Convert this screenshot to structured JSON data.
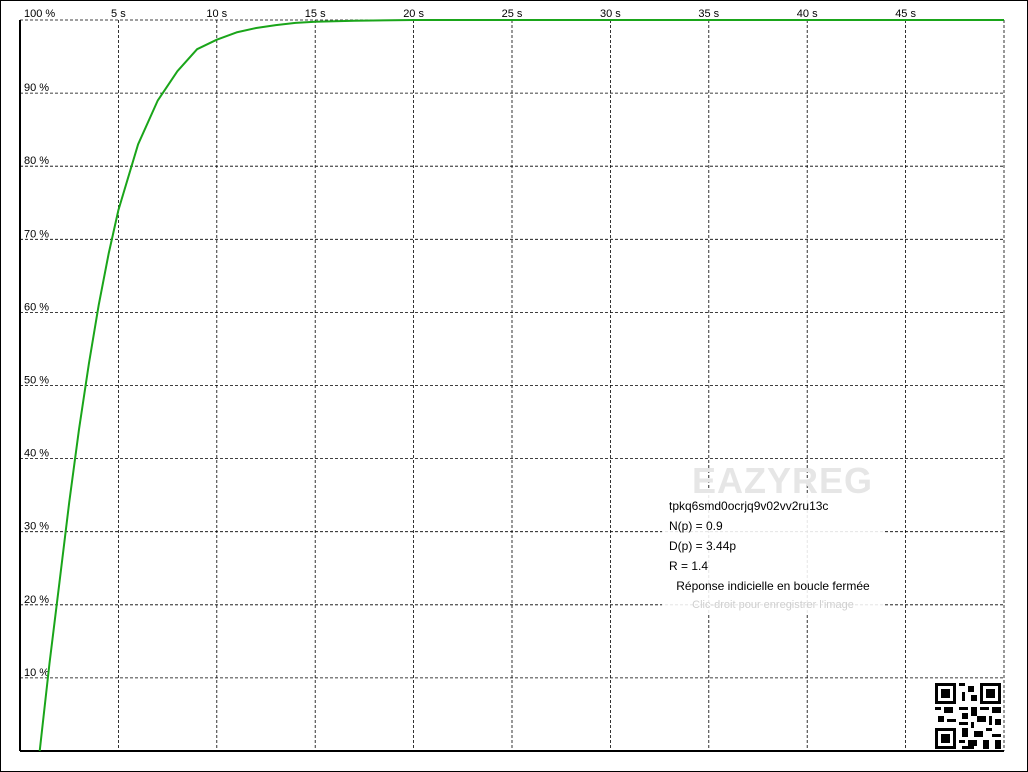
{
  "chart_data": {
    "type": "line",
    "x_tick_labels": [
      "5 s",
      "10 s",
      "15 s",
      "20 s",
      "25 s",
      "30 s",
      "35 s",
      "40 s",
      "45 s"
    ],
    "y_tick_labels": [
      "10 %",
      "20 %",
      "30 %",
      "40 %",
      "50 %",
      "60 %",
      "70 %",
      "80 %",
      "90 %",
      "100 %"
    ],
    "x_ticks": [
      5,
      10,
      15,
      20,
      25,
      30,
      35,
      40,
      45
    ],
    "y_ticks": [
      10,
      20,
      30,
      40,
      50,
      60,
      70,
      80,
      90,
      100
    ],
    "xlim": [
      0,
      50
    ],
    "ylim": [
      0,
      100
    ],
    "grid": true,
    "series": [
      {
        "color": "#1aa51a",
        "x": [
          1,
          1.5,
          2,
          2.5,
          3,
          3.5,
          4,
          4.5,
          5,
          6,
          7,
          8,
          9,
          10,
          11,
          12,
          13,
          14,
          15,
          17,
          20,
          25,
          30,
          35,
          40,
          45,
          50
        ],
        "y": [
          0,
          12,
          23,
          34,
          44,
          53,
          61,
          68,
          74,
          83,
          89,
          93,
          96,
          97.3,
          98.3,
          98.9,
          99.3,
          99.6,
          99.75,
          99.9,
          100,
          100,
          100,
          100,
          100,
          100,
          100
        ]
      }
    ]
  },
  "overlay": {
    "watermark": "EAZYREG",
    "identifier": "tpkq6smd0ocrjq9v02vv2ru13c",
    "numerator": "N(p) = 0.9",
    "denominator": "D(p) = 3.44p",
    "gain": "R = 1.4",
    "caption": "Réponse indicielle en boucle fermée",
    "hint": "Clic-droit pour enregistrer l'image"
  },
  "colors": {
    "curve": "#1aa51a",
    "grid": "#000000",
    "watermark": "#e6e6e6",
    "hint": "#cfcfcf"
  }
}
